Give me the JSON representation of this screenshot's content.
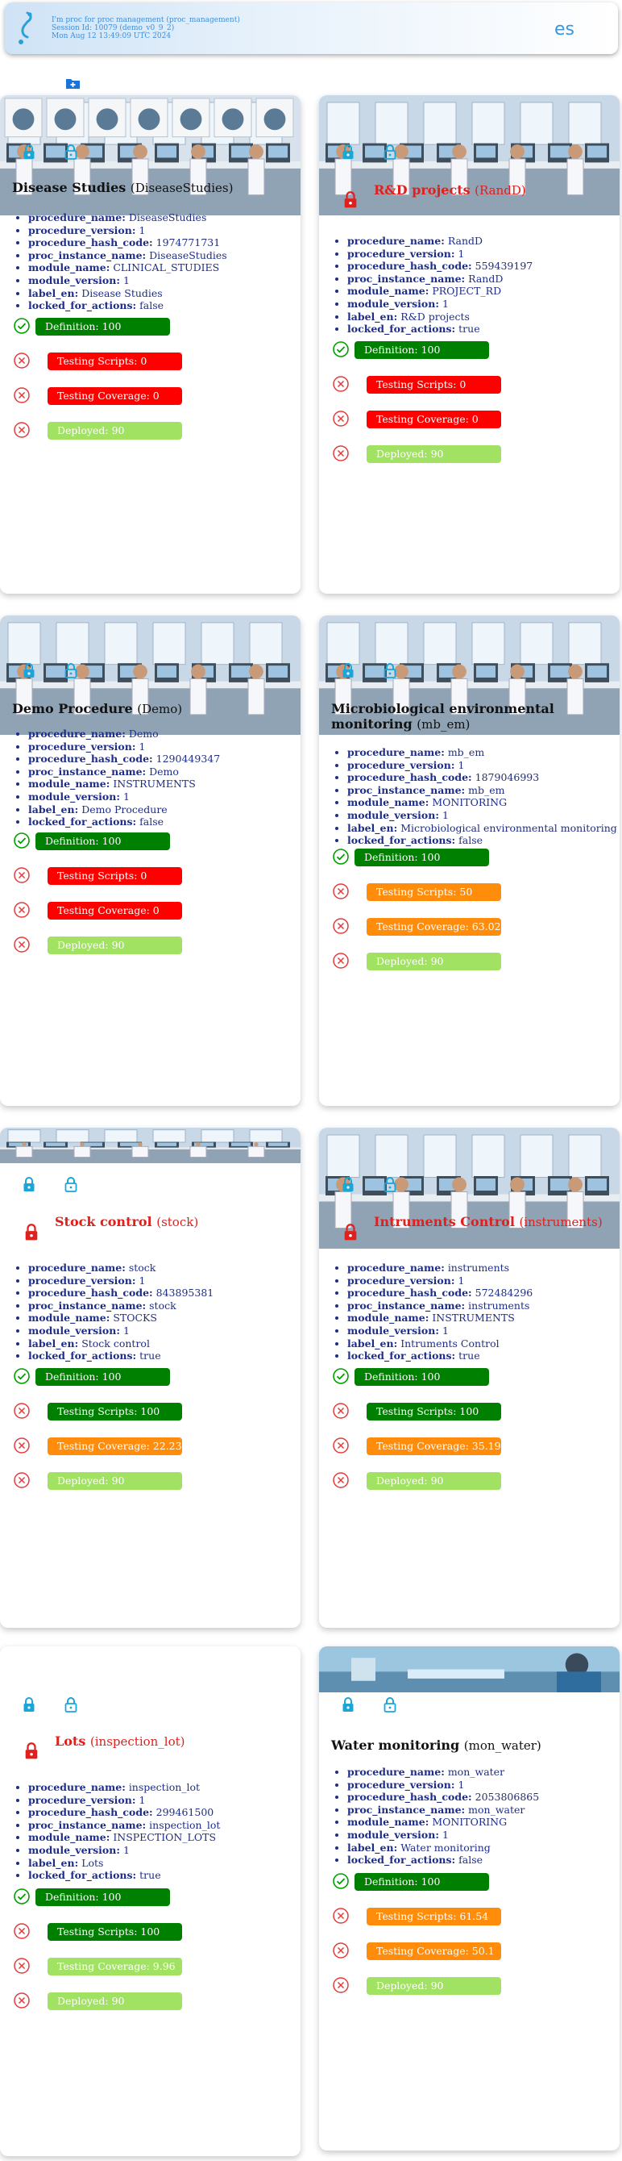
{
  "header": {
    "line1": "I'm proc for proc management (proc_management)",
    "line2": "Session Id: 10079 (demo_v0_9_2)",
    "line3": "Mon Aug 12 13:49:09 UTC 2024",
    "language": "es"
  },
  "icons": {
    "add": "add-procedure-icon",
    "lock": "lock-icon",
    "unlock": "unlock-icon",
    "check": "check-circle-icon",
    "error": "error-circle-icon"
  },
  "colors": {
    "ok": "#008000",
    "fail": "#ff0000",
    "partial": "#ff8c0a",
    "deployed": "#a2e262",
    "locked_title": "#e0201c",
    "props": "#1e2d88"
  },
  "prop_labels": [
    "procedure_name:",
    "procedure_version:",
    "procedure_hash_code:",
    "proc_instance_name:",
    "module_name:",
    "module_version:",
    "label_en:",
    "locked_for_actions:"
  ],
  "cards": [
    {
      "title": "Disease Studies",
      "code": "(DiseaseStudies)",
      "locked": false,
      "props": [
        "DiseaseStudies",
        "1",
        "1974771731",
        "DiseaseStudies",
        "CLINICAL_STUDIES",
        "1",
        "Disease Studies",
        "false"
      ],
      "stats": [
        "Definition: 100",
        "Testing Scripts: 0",
        "Testing Coverage: 0",
        "Deployed: 90"
      ]
    },
    {
      "title": "R&D projects",
      "code": "(RandD)",
      "locked": true,
      "props": [
        "RandD",
        "1",
        "559439197",
        "RandD",
        "PROJECT_RD",
        "1",
        "R&D projects",
        "true"
      ],
      "stats": [
        "Definition: 100",
        "Testing Scripts: 0",
        "Testing Coverage: 0",
        "Deployed: 90"
      ]
    },
    {
      "title": "Demo Procedure",
      "code": "(Demo)",
      "locked": false,
      "props": [
        "Demo",
        "1",
        "1290449347",
        "Demo",
        "INSTRUMENTS",
        "1",
        "Demo Procedure",
        "false"
      ],
      "stats": [
        "Definition: 100",
        "Testing Scripts: 0",
        "Testing Coverage: 0",
        "Deployed: 90"
      ]
    },
    {
      "title": "Microbiological environmental monitoring",
      "code": "(mb_em)",
      "locked": false,
      "props": [
        "mb_em",
        "1",
        "1879046993",
        "mb_em",
        "MONITORING",
        "1",
        "Microbiological environmental monitoring",
        "false"
      ],
      "stats": [
        "Definition: 100",
        "Testing Scripts: 50",
        "Testing Coverage: 63.02",
        "Deployed: 90"
      ]
    },
    {
      "title": "Stock control",
      "code": "(stock)",
      "locked": true,
      "props": [
        "stock",
        "1",
        "843895381",
        "stock",
        "STOCKS",
        "1",
        "Stock control",
        "true"
      ],
      "stats": [
        "Definition: 100",
        "Testing Scripts: 100",
        "Testing Coverage: 22.23",
        "Deployed: 90"
      ]
    },
    {
      "title": "Intruments Control",
      "code": "(instruments)",
      "locked": true,
      "props": [
        "instruments",
        "1",
        "572484296",
        "instruments",
        "INSTRUMENTS",
        "1",
        "Intruments Control",
        "true"
      ],
      "stats": [
        "Definition: 100",
        "Testing Scripts: 100",
        "Testing Coverage: 35.19",
        "Deployed: 90"
      ]
    },
    {
      "title": "Lots",
      "code": "(inspection_lot)",
      "locked": true,
      "props": [
        "inspection_lot",
        "1",
        "299461500",
        "inspection_lot",
        "INSPECTION_LOTS",
        "1",
        "Lots",
        "true"
      ],
      "stats": [
        "Definition: 100",
        "Testing Scripts: 100",
        "Testing Coverage: 9.96",
        "Deployed: 90"
      ]
    },
    {
      "title": "Water monitoring",
      "code": "(mon_water)",
      "locked": false,
      "props": [
        "mon_water",
        "1",
        "2053806865",
        "mon_water",
        "MONITORING",
        "1",
        "Water monitoring",
        "false"
      ],
      "stats": [
        "Definition: 100",
        "Testing Scripts: 61.54",
        "Testing Coverage: 50.1",
        "Deployed: 90"
      ]
    }
  ]
}
